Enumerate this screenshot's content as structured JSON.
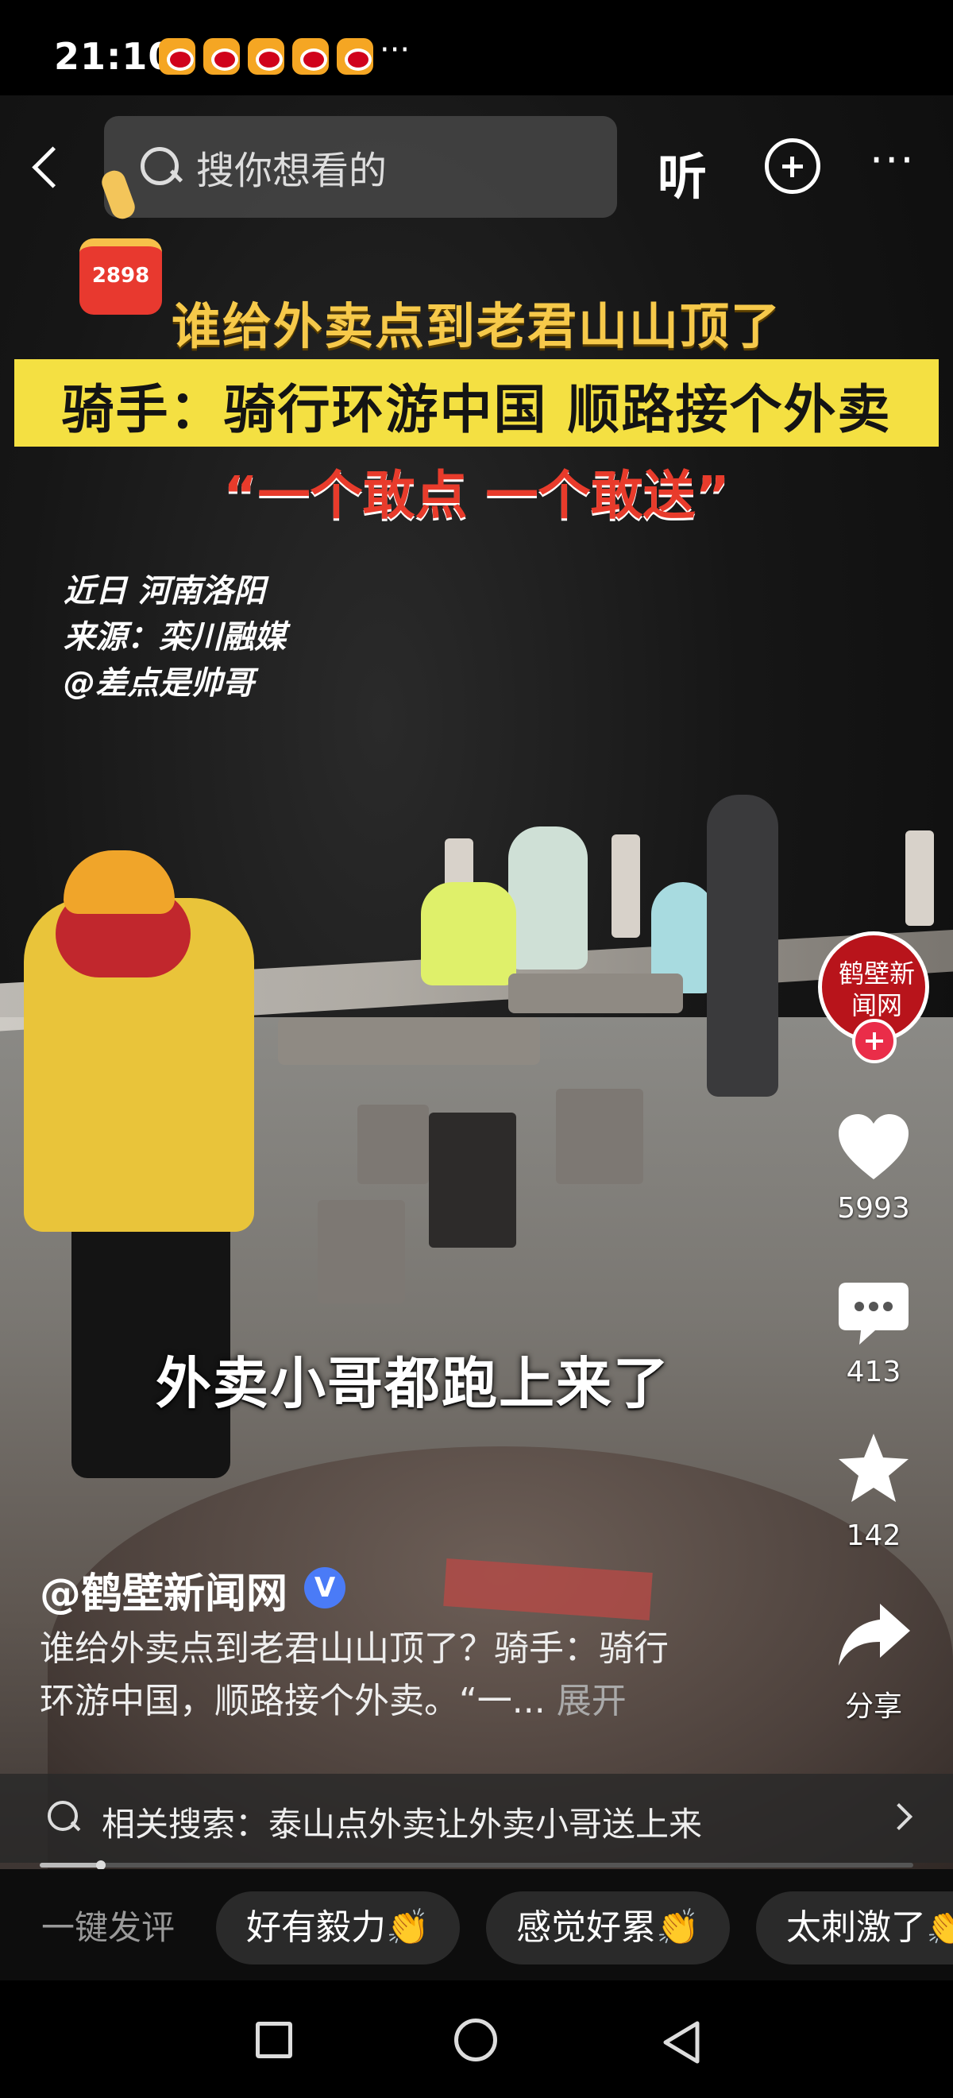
{
  "status_bar": {
    "time": "21:10",
    "more": "···"
  },
  "nav": {
    "search_placeholder": "搜你想看的",
    "listen_label": "听",
    "more_label": "···"
  },
  "reward": {
    "count": "2898"
  },
  "video": {
    "headline_1": "谁给外卖点到老君山山顶了",
    "headline_2": "骑手：骑行环游中国 顺路接个外卖",
    "headline_3": "“一个敢点 一个敢送”",
    "meta_lines": [
      "近日 河南洛阳",
      "来源：栾川融媒",
      "@差点是帅哥"
    ],
    "subtitle": "外卖小哥都跑上来了"
  },
  "account": {
    "avatar_text": "鹤壁新闻网"
  },
  "actions": {
    "likes": "5993",
    "comments": "413",
    "favorites": "142",
    "share_label": "分享"
  },
  "caption": {
    "author": "@鹤壁新闻网",
    "verified": "V",
    "desc_line_1": "谁给外卖点到老君山山顶了？骑手：骑行",
    "desc_line_2": "环游中国，顺路接个外卖。“一...",
    "expand": "展开"
  },
  "related_search": {
    "label": "相关搜索：泰山点外卖让外卖小哥送上来"
  },
  "progress": {
    "fraction": 0.07
  },
  "quick_comment": {
    "label": "一键发评",
    "chips": [
      "好有毅力👏",
      "感觉好累👏",
      "太刺激了👏"
    ]
  },
  "colors": {
    "like": "#ffffff",
    "follow": "#ea2d49",
    "verified": "#4a7bf7",
    "headline_bar": "#f4e042"
  }
}
